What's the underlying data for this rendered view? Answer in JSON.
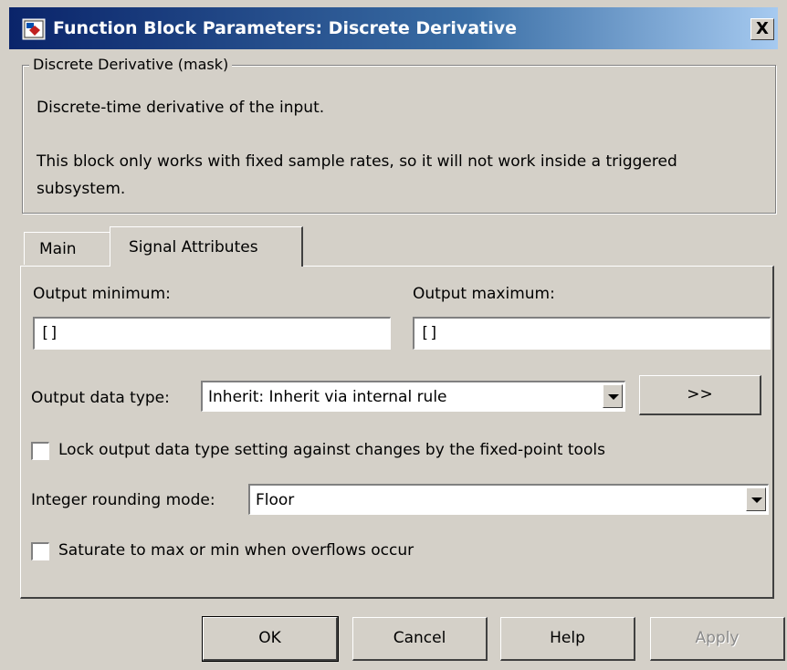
{
  "window": {
    "title": "Function Block Parameters: Discrete Derivative",
    "close_label": "X",
    "icon": "simulink-block-icon"
  },
  "mask": {
    "legend": "Discrete Derivative (mask)",
    "description_line1": "Discrete-time derivative of the input.",
    "description_line2": "This block only works with fixed sample rates, so it will not work inside a triggered subsystem."
  },
  "tabs": [
    {
      "label": "Main",
      "active": false
    },
    {
      "label": "Signal Attributes",
      "active": true
    }
  ],
  "signal_attributes": {
    "output_min_label": "Output minimum:",
    "output_min_value": "[]",
    "output_max_label": "Output maximum:",
    "output_max_value": "[]",
    "output_data_type_label": "Output data type:",
    "output_data_type_value": "Inherit: Inherit via internal rule",
    "assistant_button": ">>",
    "lock_label": "Lock output data type setting against changes by the fixed-point tools",
    "lock_checked": false,
    "rounding_label": "Integer rounding mode:",
    "rounding_value": "Floor",
    "saturate_label": "Saturate to max or min when overflows occur",
    "saturate_checked": false
  },
  "buttons": {
    "ok": "OK",
    "cancel": "Cancel",
    "help": "Help",
    "apply": "Apply"
  }
}
